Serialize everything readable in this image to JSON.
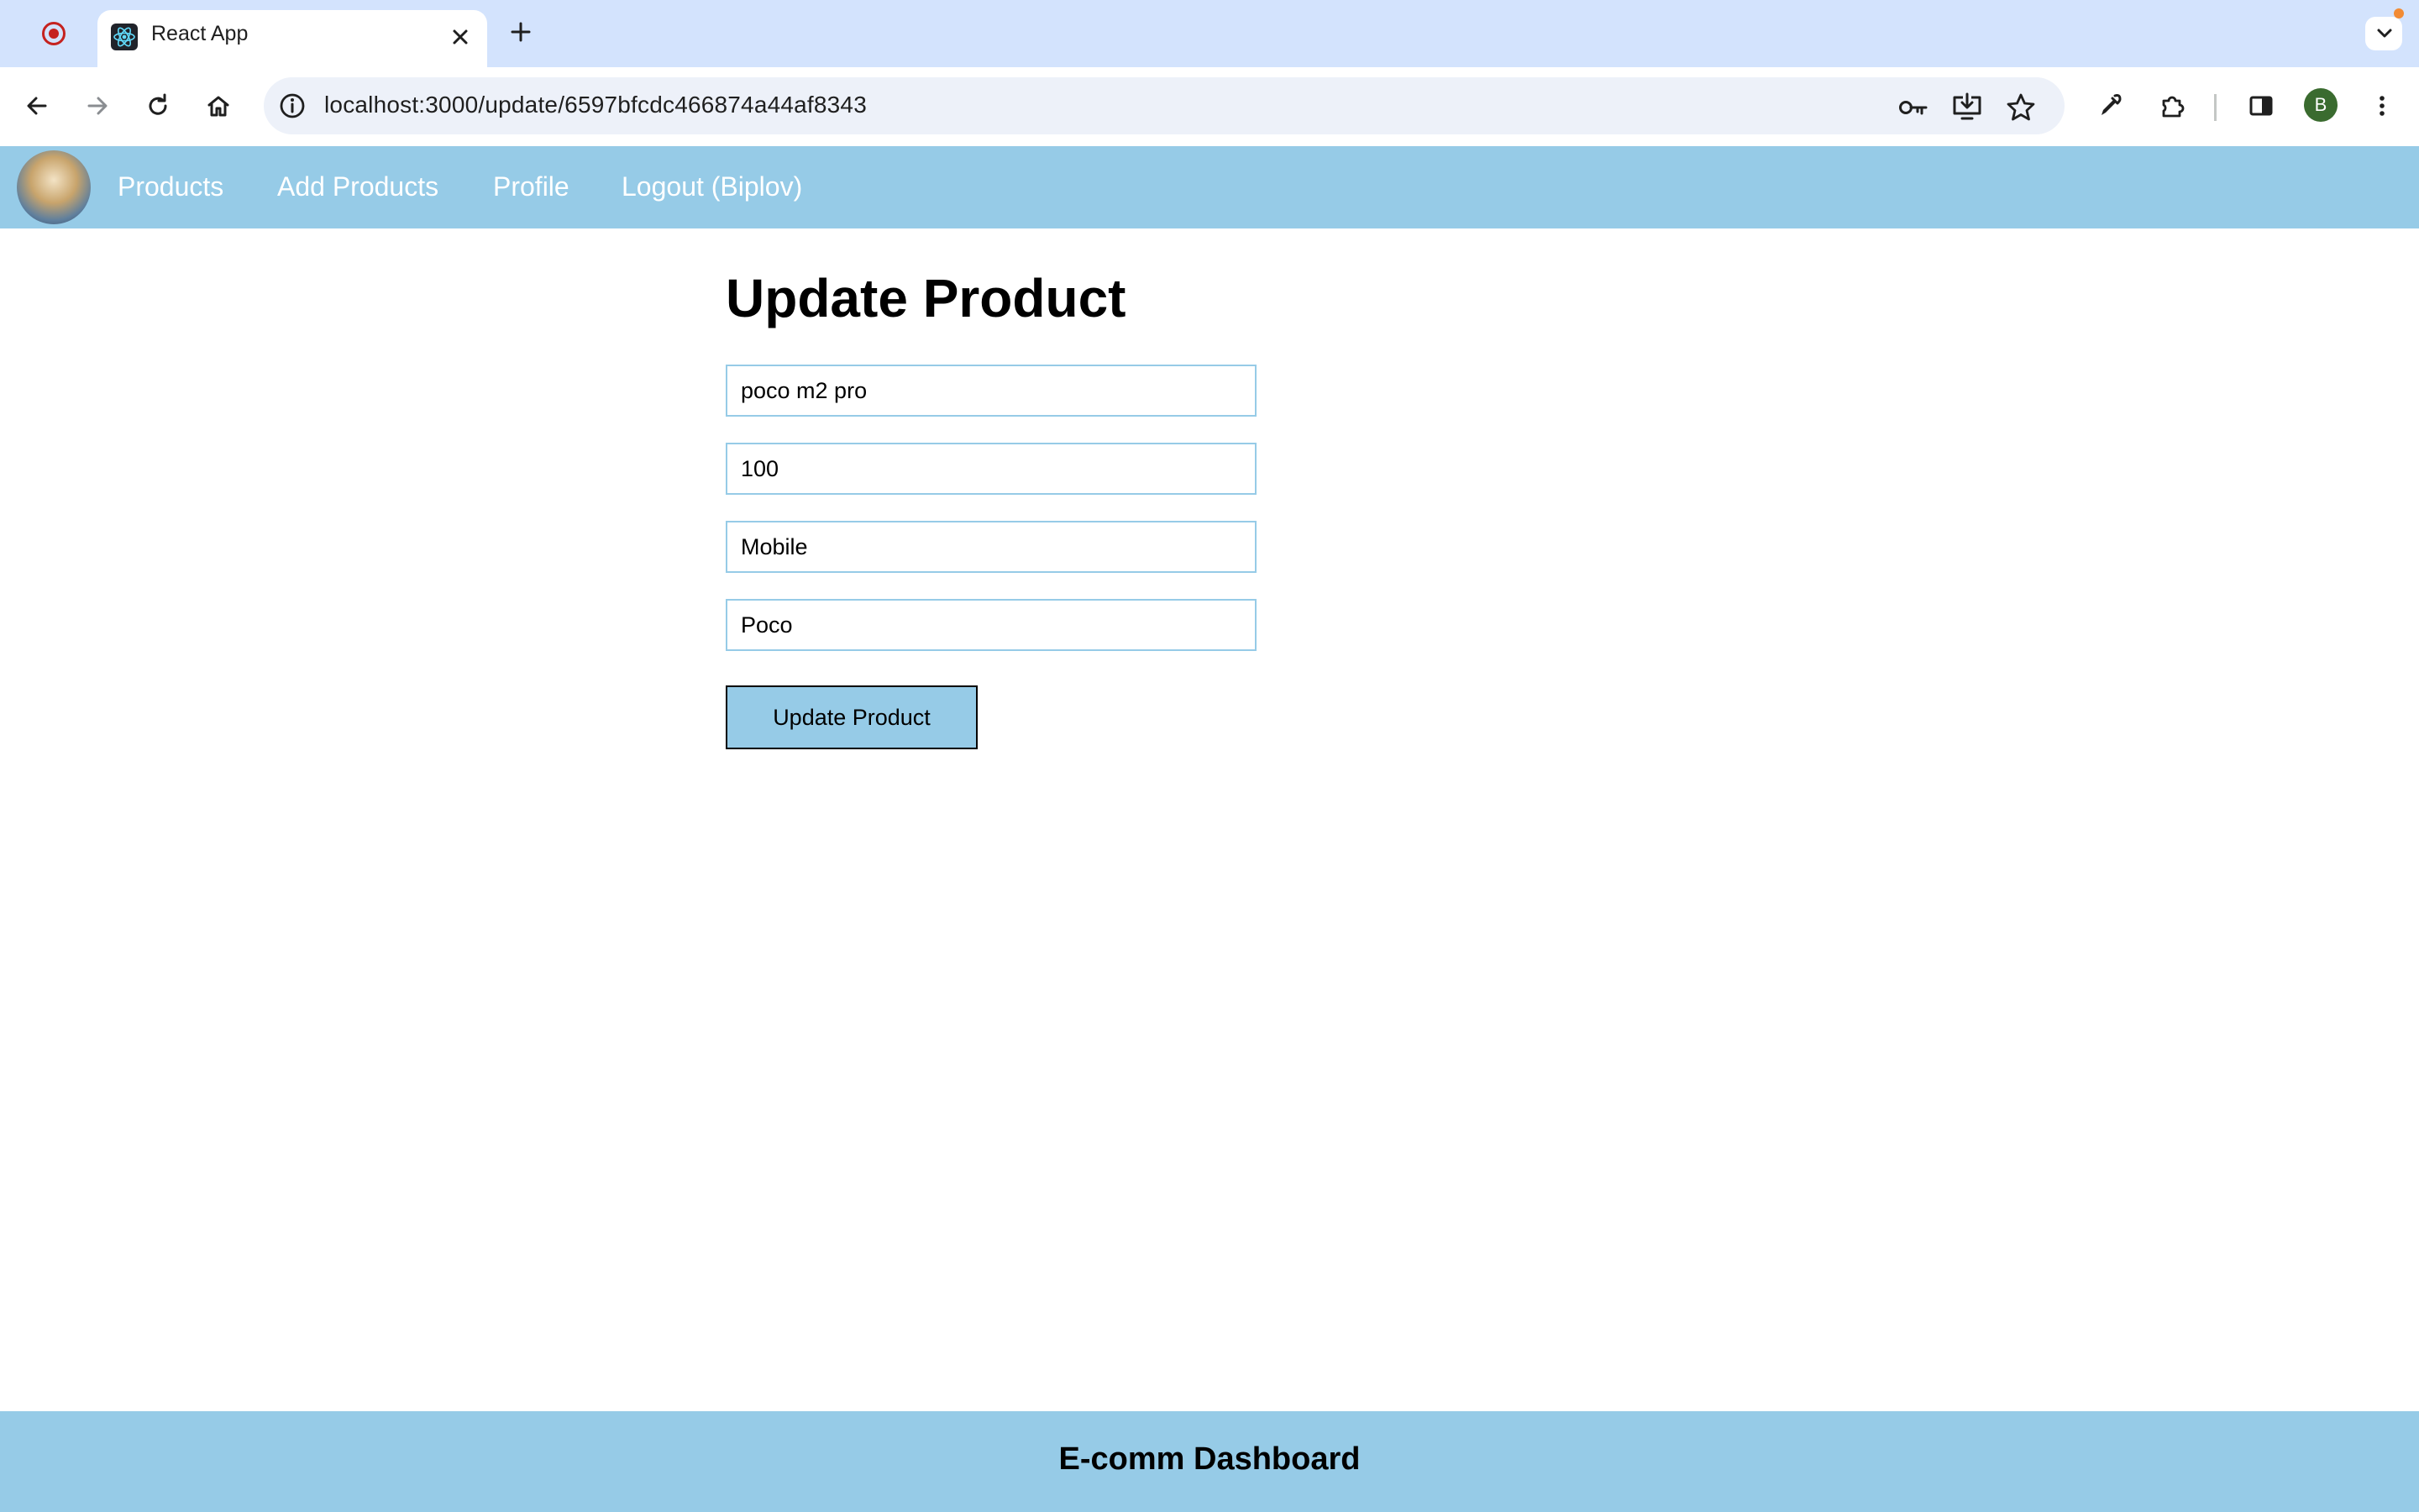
{
  "browser": {
    "tab_title": "React App",
    "url": "localhost:3000/update/6597bfcdc466874a44af8343",
    "profile_initial": "B",
    "icons": [
      "record-icon",
      "react-favicon",
      "close-icon",
      "plus-icon",
      "chevron-down-icon",
      "back-icon",
      "forward-icon",
      "reload-icon",
      "home-icon",
      "info-icon",
      "key-icon",
      "install-icon",
      "star-icon",
      "eyedropper-icon",
      "extensions-icon",
      "side-panel-icon",
      "kebab-menu-icon"
    ]
  },
  "nav": {
    "links": [
      "Products",
      "Add Products",
      "Profile",
      "Logout (Biplov)"
    ]
  },
  "form": {
    "title": "Update Product",
    "name_value": "poco m2 pro",
    "price_value": "100",
    "category_value": "Mobile",
    "company_value": "Poco",
    "submit_label": "Update Product"
  },
  "footer": {
    "text": "E-comm Dashboard"
  },
  "colors": {
    "accent": "#96cbe7",
    "tabstrip": "#d3e3fd",
    "omnibox": "#edf1f9"
  }
}
